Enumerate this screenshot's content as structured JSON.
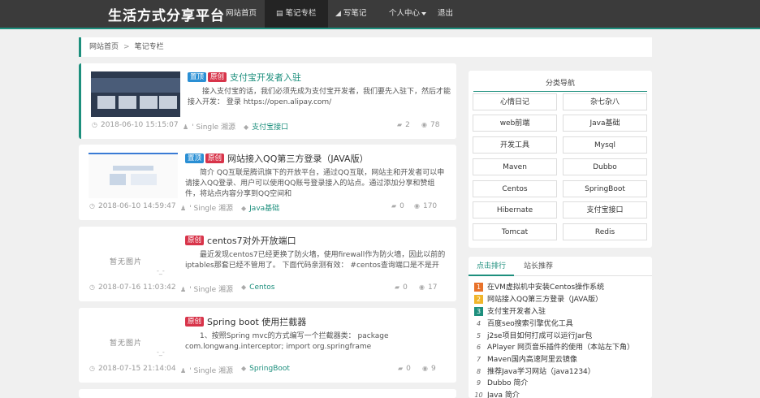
{
  "nav": {
    "brand": "生活方式分享平台",
    "items": [
      {
        "label": "网站首页",
        "icon": "home",
        "glyph": ""
      },
      {
        "label": "笔记专栏",
        "icon": "file-icon",
        "glyph": "▤"
      },
      {
        "label": "写笔记",
        "icon": "send-icon",
        "glyph": "◢"
      },
      {
        "label": "个人中心",
        "icon": "",
        "glyph": ""
      },
      {
        "label": "退出",
        "icon": "",
        "glyph": ""
      }
    ]
  },
  "breadcrumb": {
    "home": "网站首页",
    "sep": ">",
    "current": "笔记专栏"
  },
  "articles": [
    {
      "tags": [
        "置顶",
        "原创"
      ],
      "title": "支付宝开发者入驻",
      "summary": "接入支付宝的话，我们必须先成为支付宝开发者，我们要先入驻下，然后才能接入开发：  登录 https://open.alipay.com/",
      "date": "2018-06-10 15:15:07",
      "author": "' Single 湘源",
      "category": "支付宝接口",
      "comments": "2",
      "views": "78"
    },
    {
      "tags": [
        "置顶",
        "原创"
      ],
      "title": "网站接入QQ第三方登录（JAVA版）",
      "summary": "简介 QQ互联是腾讯旗下的开放平台，通过QQ互联，网站主和开发者可以申请接入QQ登录、用户可以使用QQ账号登录接入的站点。通过添加分享和赞组件，将站点内容分享到QQ空间和",
      "date": "2018-06-10 14:59:47",
      "author": "' Single 湘源",
      "category": "Java基础",
      "comments": "0",
      "views": "170"
    },
    {
      "tags": [
        "原创"
      ],
      "title": "centos7对外开放端口",
      "summary": "最近发现centos7已经更换了防火墙，使用firewall作为防火墙，因此以前的iptables那套已经不管用了。 下面代码亲测有效： #centos查询端口是不是开",
      "date": "2018-07-16 11:03:42",
      "author": "' Single 湘源",
      "category": "Centos",
      "comments": "0",
      "views": "17",
      "noimage": "暂无图片",
      "noimage_dots": "-_-"
    },
    {
      "tags": [
        "原创"
      ],
      "title": "Spring boot 使用拦截器",
      "summary": "1、按照Spring mvc的方式编写一个拦截器类： package com.longwang.interceptor; import org.springframe",
      "date": "2018-07-15 21:14:04",
      "author": "' Single 湘源",
      "category": "SpringBoot",
      "comments": "0",
      "views": "9",
      "noimage": "暂无图片",
      "noimage_dots": "-_-"
    }
  ],
  "categories": {
    "title": "分类导航",
    "items": [
      "心情日记",
      "杂七杂八",
      "web前端",
      "Java基础",
      "开发工具",
      "Mysql",
      "Maven",
      "Dubbo",
      "Centos",
      "SpringBoot",
      "Hibernate",
      "支付宝接口",
      "Tomcat",
      "Redis"
    ]
  },
  "ranking": {
    "tabs": [
      "点击排行",
      "站长推荐"
    ],
    "items": [
      "在VM虚拟机中安装Centos操作系统",
      "网站接入QQ第三方登录（JAVA版）",
      "支付宝开发者入驻",
      "百度seo搜索引擎优化工具",
      "j2se项目如何打成可以运行Jar包",
      "APlayer 网页音乐插件的使用（本站左下角）",
      "Maven国内高速阿里云镜像",
      "推荐Java学习网站（java1234）",
      "Dubbo 简介",
      "Java 简介"
    ]
  },
  "colors": {
    "accent": "#1d8f7d",
    "navbar": "#3b3b3b",
    "tag_top": "#2a8fd4",
    "tag_orig": "#d8344a"
  }
}
